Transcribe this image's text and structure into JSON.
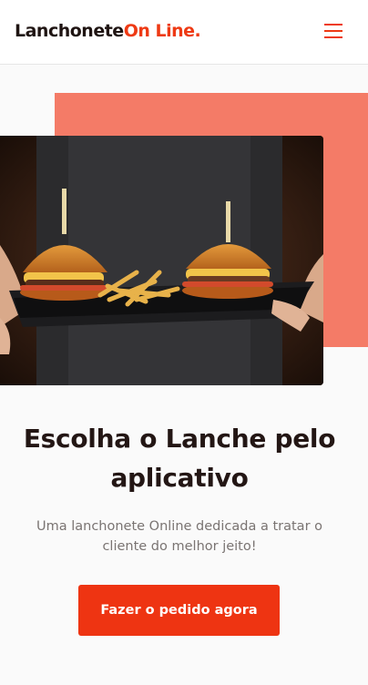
{
  "header": {
    "logo_part1": "Lanchonete",
    "logo_part2": "On Line.",
    "menu_icon": "hamburger-menu-icon"
  },
  "hero": {
    "image_desc_icon": "burger-tray-photo",
    "title": "Escolha o Lanche pelo aplicativo",
    "description": "Uma lanchonete Online dedicada a tratar o cliente do melhor jeito!",
    "cta_label": "Fazer o pedido agora"
  },
  "colors": {
    "accent": "#ee3a14",
    "hero_bg": "#f47b67",
    "title": "#231614",
    "text_muted": "#7a7472"
  }
}
